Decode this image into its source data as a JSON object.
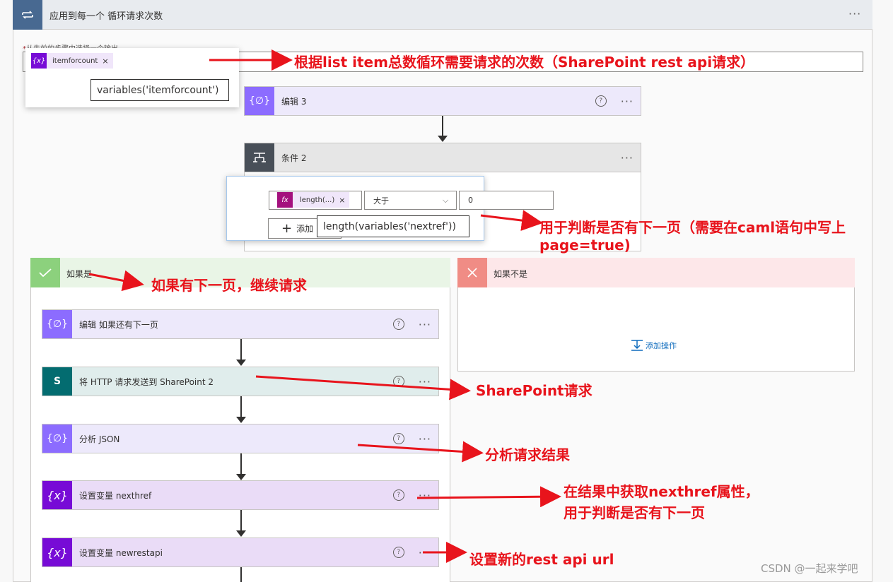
{
  "loop": {
    "title": "应用到每一个 循环请求次数",
    "icon": "loop-icon",
    "menu": "···"
  },
  "select_output": {
    "label": "从先前的步骤中选择一个输出",
    "required_mark": "*",
    "token_label": "itemforcount",
    "token_icon": "{x}",
    "token_remove": "×",
    "tooltip": "variables('itemforcount')"
  },
  "compose3": {
    "title": "编辑 3",
    "icon": "{∅}",
    "help": "?",
    "menu": "···"
  },
  "condition": {
    "title": "条件 2",
    "icon": "condition-icon",
    "menu": "···",
    "token_label": "length(...)",
    "token_icon": "fx",
    "token_remove": "×",
    "operator": "大于",
    "value": "0",
    "add_label": "添加",
    "tooltip": "length(variables('nextref'))"
  },
  "yes_branch": {
    "title": "如果是",
    "icon": "check-icon"
  },
  "no_branch": {
    "title": "如果不是",
    "icon": "x-icon",
    "add_action": "添加操作"
  },
  "actions": [
    {
      "title": "编辑 如果还有下一页",
      "icon": "{∅}",
      "help": "?",
      "menu": "···"
    },
    {
      "title": "将 HTTP 请求发送到 SharePoint 2",
      "icon": "S",
      "help": "?",
      "menu": "···"
    },
    {
      "title": "分析 JSON",
      "icon": "{∅}",
      "help": "?",
      "menu": "···"
    },
    {
      "title": "设置变量 nexthref",
      "icon": "{x}",
      "help": "?",
      "menu": "···"
    },
    {
      "title": "设置变量 newrestapi",
      "icon": "{x}",
      "help": "?",
      "menu": "···"
    }
  ],
  "annotations": {
    "loop_count": "根据list item总数循环需要请求的次数（SharePoint rest api请求）",
    "next_page_1": "用于判断是否有下一页（需要在caml语句中写上",
    "next_page_2": "page=true)",
    "continue": "如果有下一页，继续请求",
    "sp_request": "SharePoint请求",
    "parse_result": "分析请求结果",
    "get_nexthref_1": "在结果中获取nexthref属性，",
    "get_nexthref_2": "用于判断是否有下一页",
    "set_url": "设置新的rest api url"
  },
  "watermark": "CSDN @一起来学吧",
  "colors": {
    "loop_header": "#486991",
    "compose": "#8c6cff",
    "variable": "#770bd6",
    "sharepoint": "#036c70",
    "condition": "#484f58",
    "yes": "#8cd17d",
    "no": "#f08c85",
    "annotation": "#e8141c"
  }
}
